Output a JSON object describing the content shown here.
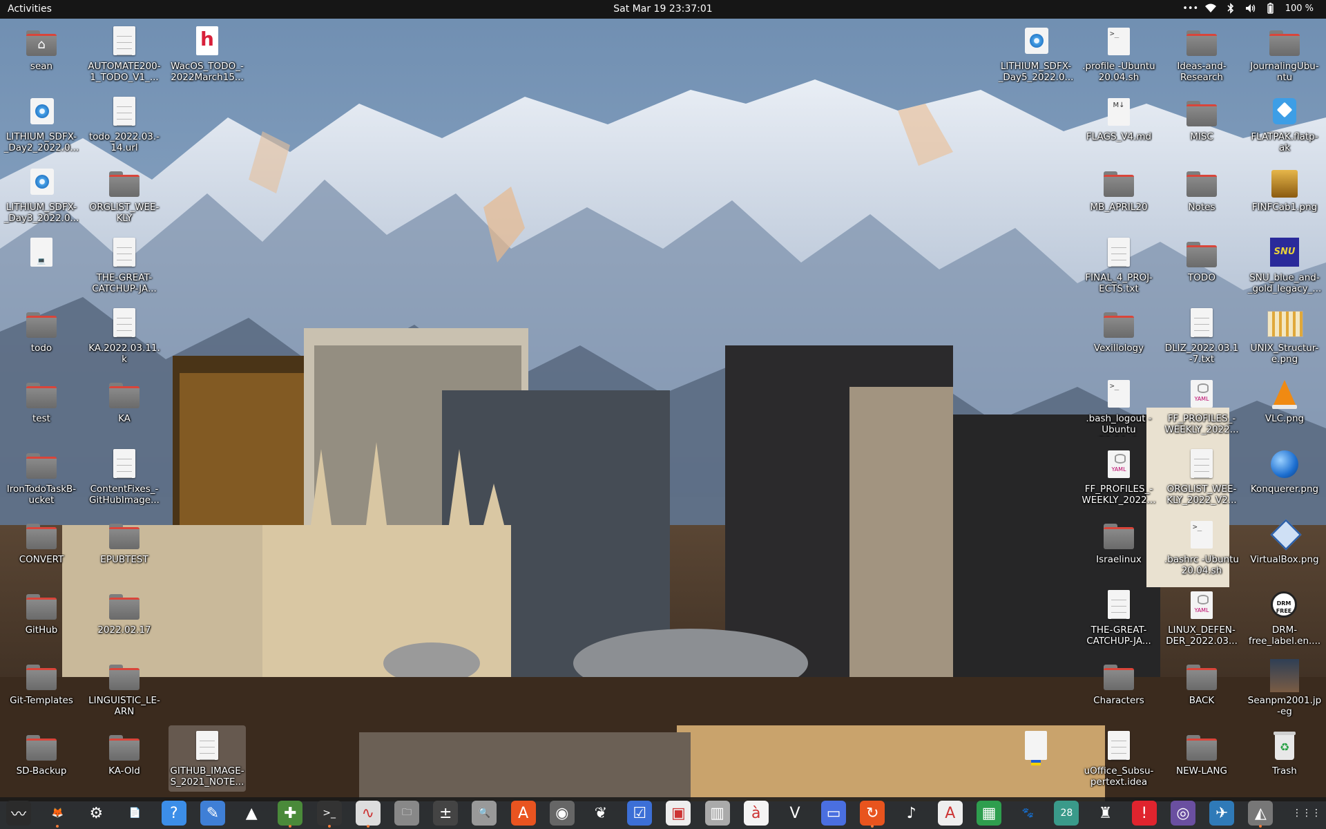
{
  "topbar": {
    "activities": "Activities",
    "clock": "Sat Mar 19  23:37:01",
    "battery": "100 %",
    "icons": [
      "more-icon",
      "wifi-icon",
      "bluetooth-icon",
      "volume-icon",
      "battery-icon"
    ]
  },
  "desktop": {
    "left": [
      {
        "name": "sean",
        "type": "home"
      },
      {
        "name": "AUTOMATE200-1_TODO_V1_...",
        "type": "doc"
      },
      {
        "name": "WacOS_TODO_-2022March15...",
        "type": "h"
      },
      {
        "name": "LITHIUM_SDFX-_Day2_2022.0...",
        "type": "blue"
      },
      {
        "name": "todo_2022.03.-14.url",
        "type": "doc"
      },
      {
        "name": "LITHIUM_SDFX-_Day3_2022.0...",
        "type": "blue"
      },
      {
        "name": "ORGLIST_WEE-KLY",
        "type": "folder"
      },
      {
        "name": "",
        "type": "laptop"
      },
      {
        "name": "THE-GREAT-CATCHUP-JA...",
        "type": "doc"
      },
      {
        "name": "todo",
        "type": "folder"
      },
      {
        "name": "KA.2022.03.11.k",
        "type": "doc"
      },
      {
        "name": "test",
        "type": "folder"
      },
      {
        "name": "KA",
        "type": "folder"
      },
      {
        "name": "IronTodoTaskB-ucket",
        "type": "folder"
      },
      {
        "name": "ContentFixes_-GitHubImage...",
        "type": "doc"
      },
      {
        "name": "CONVERT",
        "type": "folder"
      },
      {
        "name": "EPUBTEST",
        "type": "folder"
      },
      {
        "name": "GitHub",
        "type": "folder"
      },
      {
        "name": "2022.02.17",
        "type": "folder"
      },
      {
        "name": "Git-Templates",
        "type": "folder"
      },
      {
        "name": "LINGUISTIC_LE-ARN",
        "type": "folder"
      },
      {
        "name": "SD-Backup",
        "type": "folder"
      },
      {
        "name": "KA-Old",
        "type": "folder"
      },
      {
        "name": "GITHUB_IMAGE-S_2021_NOTE...",
        "type": "doc"
      }
    ],
    "right": [
      {
        "name": "LITHIUM_SDFX-_Day5_2022.0...",
        "type": "blue"
      },
      {
        "name": ".profile -Ubuntu 20.04.sh",
        "type": "term"
      },
      {
        "name": "Ideas-and-Research",
        "type": "folder"
      },
      {
        "name": "JournalingUbu-ntu",
        "type": "folder"
      },
      {
        "name": "FLAGS_V4.md",
        "type": "md"
      },
      {
        "name": "MISC",
        "type": "folder"
      },
      {
        "name": "FLATPAK.flatp-ak",
        "type": "flatpak"
      },
      {
        "name": "MB_APRIL20",
        "type": "folder"
      },
      {
        "name": "Notes",
        "type": "folder"
      },
      {
        "name": "FINFCab1.png",
        "type": "cabinet"
      },
      {
        "name": "FINAL_4_PROJ-ECTS.txt",
        "type": "doc"
      },
      {
        "name": "TODO",
        "type": "folder"
      },
      {
        "name": "SNU_blue_and-_gold_legacy_...",
        "type": "snu"
      },
      {
        "name": "Vexillology",
        "type": "folder"
      },
      {
        "name": "DLIZ_2022.03.1-7.txt",
        "type": "doc"
      },
      {
        "name": "UNIX_Structur-e.png",
        "type": "unix"
      },
      {
        "name": ".bash_logout -Ubuntu 20.04.sh",
        "type": "term"
      },
      {
        "name": "FF_PROFILES_-WEEKLY_2022...",
        "type": "yaml"
      },
      {
        "name": "VLC.png",
        "type": "vlc"
      },
      {
        "name": "FF_PROFILES_-WEEKLY_2022...",
        "type": "yaml"
      },
      {
        "name": "ORGLIST_WEE-KLY_2022_V2...",
        "type": "doc"
      },
      {
        "name": "Konquerer.png",
        "type": "konq"
      },
      {
        "name": "Israelinux",
        "type": "folder"
      },
      {
        "name": ".bashrc -Ubuntu 20.04.sh",
        "type": "term"
      },
      {
        "name": "VirtualBox.png",
        "type": "vbox"
      },
      {
        "name": "THE-GREAT-CATCHUP-JA...",
        "type": "doc"
      },
      {
        "name": "LINUX_DEFEN-DER_2022.03...",
        "type": "yaml"
      },
      {
        "name": "DRM-free_label.en....",
        "type": "drm"
      },
      {
        "name": "Characters",
        "type": "folder"
      },
      {
        "name": "BACK",
        "type": "folder"
      },
      {
        "name": "Seanpm2001.jp-eg",
        "type": "photo"
      },
      {
        "name": "",
        "type": "flag"
      },
      {
        "name": "uOffice_Subsu-pertext.idea",
        "type": "doc"
      },
      {
        "name": "NEW-LANG",
        "type": "folder"
      },
      {
        "name": "Trash",
        "type": "trash"
      }
    ]
  },
  "dock": {
    "items": [
      {
        "name": "system-monitor-icon",
        "glyph": "〰",
        "bg": "#2b2b2b"
      },
      {
        "name": "firefox-icon",
        "glyph": "🦊",
        "bg": "transparent"
      },
      {
        "name": "settings-icon",
        "glyph": "⚙",
        "bg": "transparent"
      },
      {
        "name": "text-document-icon",
        "glyph": "📄",
        "bg": "transparent"
      },
      {
        "name": "help-icon",
        "glyph": "?",
        "bg": "#3c8ee8"
      },
      {
        "name": "text-editor-icon",
        "glyph": "✎",
        "bg": "#3f7fd6"
      },
      {
        "name": "vlc-icon",
        "glyph": "▲",
        "bg": "transparent"
      },
      {
        "name": "puzzle-icon",
        "glyph": "✚",
        "bg": "#4a8a3a"
      },
      {
        "name": "terminal-icon",
        "glyph": ">_",
        "bg": "#333"
      },
      {
        "name": "oscilloscope-icon",
        "glyph": "∿",
        "bg": "#ddd"
      },
      {
        "name": "files-icon",
        "glyph": "🗀",
        "bg": "#888"
      },
      {
        "name": "calculator-icon",
        "glyph": "±",
        "bg": "#444"
      },
      {
        "name": "image-viewer-icon",
        "glyph": "🔍",
        "bg": "#999"
      },
      {
        "name": "software-center-icon",
        "glyph": "A",
        "bg": "#e95420"
      },
      {
        "name": "disk-utility-icon",
        "glyph": "◉",
        "bg": "#666"
      },
      {
        "name": "reader-icon",
        "glyph": "❦",
        "bg": "transparent"
      },
      {
        "name": "tasks-icon",
        "glyph": "☑",
        "bg": "#3c6fd6"
      },
      {
        "name": "screenshot-icon",
        "glyph": "▣",
        "bg": "#eee"
      },
      {
        "name": "archive-icon",
        "glyph": "▥",
        "bg": "#aaa"
      },
      {
        "name": "character-map-icon",
        "glyph": "à",
        "bg": "#f4f4f4"
      },
      {
        "name": "vim-icon",
        "glyph": "V",
        "bg": "transparent"
      },
      {
        "name": "remote-desktop-icon",
        "glyph": "▭",
        "bg": "#4a6fe0"
      },
      {
        "name": "update-icon",
        "glyph": "↻",
        "bg": "#e8541e"
      },
      {
        "name": "music-icon",
        "glyph": "♪",
        "bg": "transparent"
      },
      {
        "name": "pdf-reader-icon",
        "glyph": "A",
        "bg": "#eee"
      },
      {
        "name": "spreadsheet-icon",
        "glyph": "▦",
        "bg": "#2e9e4e"
      },
      {
        "name": "gimp-icon",
        "glyph": "🐾",
        "bg": "transparent"
      },
      {
        "name": "calendar-icon",
        "glyph": "28",
        "bg": "#3a9a8a"
      },
      {
        "name": "mario-icon",
        "glyph": "♜",
        "bg": "transparent"
      },
      {
        "name": "error-report-icon",
        "glyph": "!",
        "bg": "#e0242e"
      },
      {
        "name": "webcam-icon",
        "glyph": "◎",
        "bg": "#6a4fa0"
      },
      {
        "name": "image-editor-icon",
        "glyph": "✈",
        "bg": "#2f7ab8"
      },
      {
        "name": "backup-icon",
        "glyph": "◭",
        "bg": "#777"
      },
      {
        "name": "show-apps-icon",
        "glyph": "⋮⋮⋮",
        "bg": "transparent"
      }
    ]
  }
}
